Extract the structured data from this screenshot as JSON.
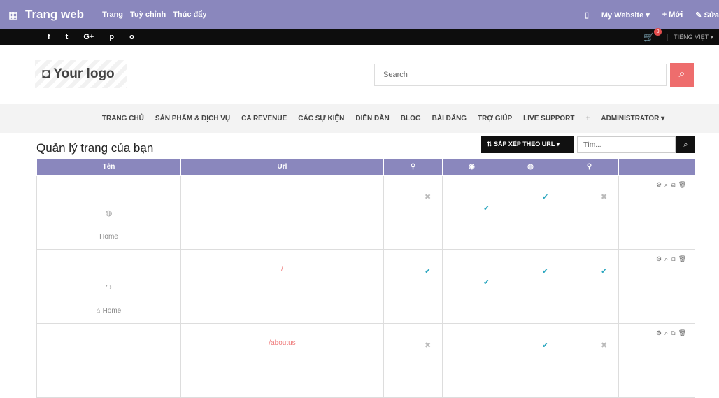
{
  "topbar": {
    "app_title": "Trang web",
    "nav": [
      "Trang",
      "Tuỳ chỉnh",
      "Thúc đẩy"
    ],
    "site": "My Website ▾",
    "new": "+ Mới",
    "edit": "✎ Sửa"
  },
  "social": [
    "f",
    "t",
    "G+",
    "p",
    "o"
  ],
  "language": "TIẾNG VIỆT ▾",
  "cart_count": "0",
  "logo": "◘ Your logo",
  "search_placeholder": "Search",
  "menu": [
    "TRANG CHỦ",
    "SẢN PHẨM & DỊCH VỤ",
    "CA REVENUE",
    "CÁC SỰ KIỆN",
    "DIỄN ĐÀN",
    "BLOG",
    "BÀI ĐĂNG",
    "TRỢ GIÚP",
    "LIVE SUPPORT",
    "+",
    "ADMINISTRATOR ▾"
  ],
  "page_title": "Quản lý trang của bạn",
  "sort_label": "⇅ SẮP XẾP THEO URL ▾",
  "search_small_placeholder": "Tìm...",
  "table": {
    "headers": [
      "Tên",
      "Url",
      "⚲",
      "◉",
      "◍",
      "⚲",
      ""
    ],
    "rows": [
      {
        "icon": "◍",
        "name": "Home",
        "url": ""
      },
      {
        "icon": "↪",
        "name": "⌂ Home",
        "url": "/"
      },
      {
        "icon": "",
        "name": "",
        "url": "/aboutus"
      }
    ]
  }
}
